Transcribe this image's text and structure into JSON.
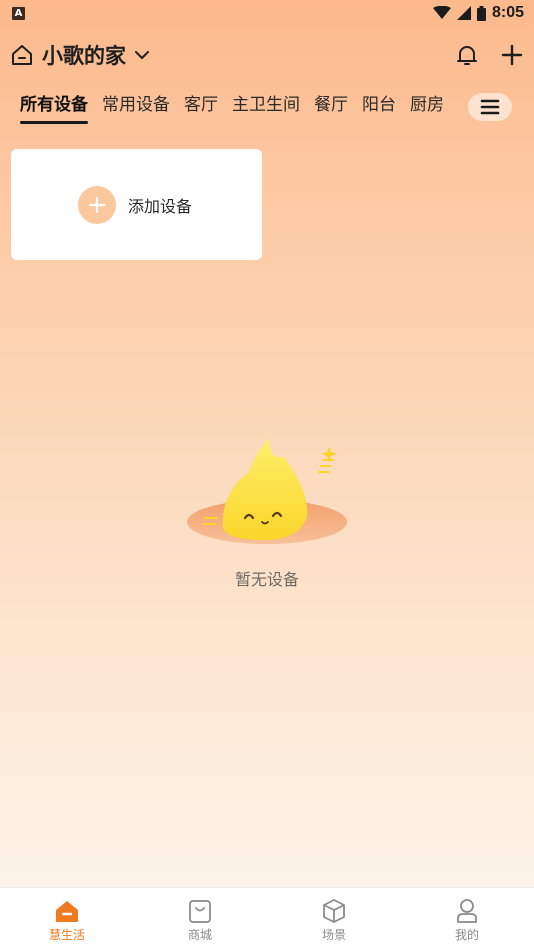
{
  "status_bar": {
    "left_badge": "A",
    "time": "8:05"
  },
  "header": {
    "home_name": "小歌的家"
  },
  "tabs": [
    {
      "label": "所有设备",
      "active": true
    },
    {
      "label": "常用设备",
      "active": false
    },
    {
      "label": "客厅",
      "active": false
    },
    {
      "label": "主卫生间",
      "active": false
    },
    {
      "label": "餐厅",
      "active": false
    },
    {
      "label": "阳台",
      "active": false
    },
    {
      "label": "厨房",
      "active": false
    }
  ],
  "add_device": {
    "label": "添加设备"
  },
  "empty_state": {
    "text": "暂无设备"
  },
  "bottom_nav": [
    {
      "label": "慧生活",
      "icon": "home-icon",
      "active": true
    },
    {
      "label": "商城",
      "icon": "shopping-bag-icon",
      "active": false
    },
    {
      "label": "场景",
      "icon": "cube-icon",
      "active": false
    },
    {
      "label": "我的",
      "icon": "user-icon",
      "active": false
    }
  ],
  "colors": {
    "accent": "#f07a1f",
    "card_plus": "#fbc79c",
    "tab_menu_bg": "#fde3cf"
  }
}
